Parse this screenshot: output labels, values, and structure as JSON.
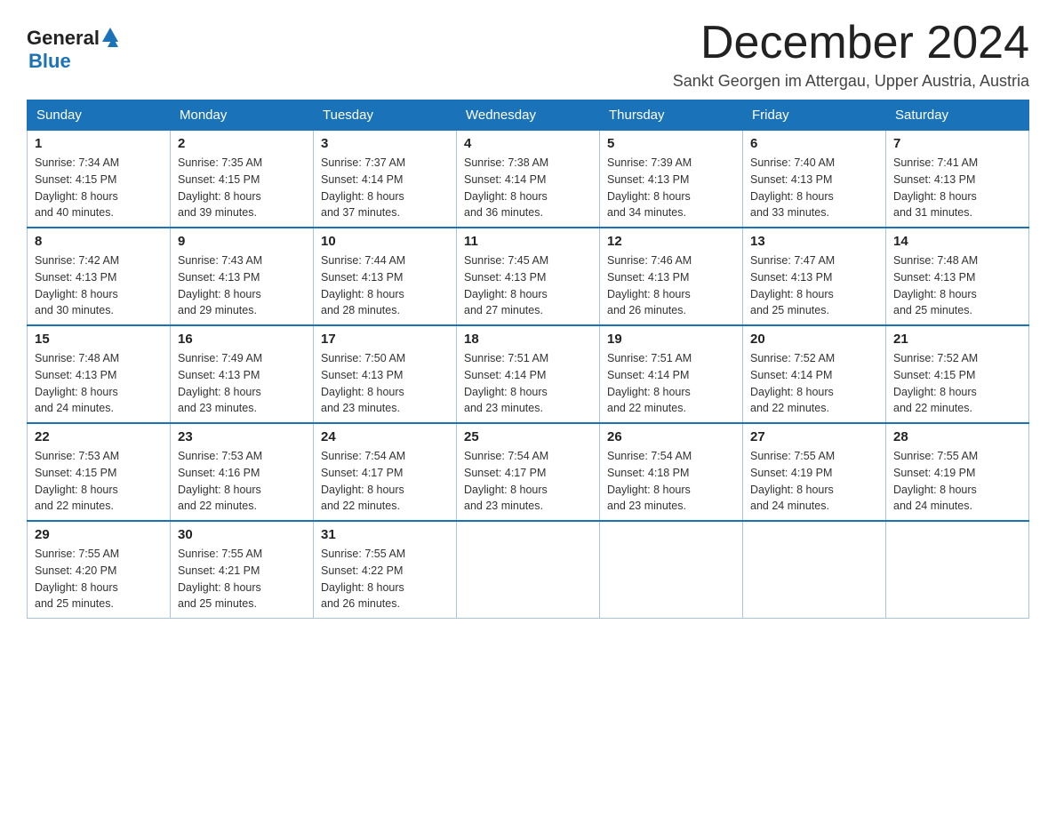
{
  "logo": {
    "general": "General",
    "blue": "Blue"
  },
  "title": "December 2024",
  "location": "Sankt Georgen im Attergau, Upper Austria, Austria",
  "days_header": [
    "Sunday",
    "Monday",
    "Tuesday",
    "Wednesday",
    "Thursday",
    "Friday",
    "Saturday"
  ],
  "weeks": [
    [
      {
        "day": "1",
        "sunrise": "7:34 AM",
        "sunset": "4:15 PM",
        "daylight": "8 hours and 40 minutes."
      },
      {
        "day": "2",
        "sunrise": "7:35 AM",
        "sunset": "4:15 PM",
        "daylight": "8 hours and 39 minutes."
      },
      {
        "day": "3",
        "sunrise": "7:37 AM",
        "sunset": "4:14 PM",
        "daylight": "8 hours and 37 minutes."
      },
      {
        "day": "4",
        "sunrise": "7:38 AM",
        "sunset": "4:14 PM",
        "daylight": "8 hours and 36 minutes."
      },
      {
        "day": "5",
        "sunrise": "7:39 AM",
        "sunset": "4:13 PM",
        "daylight": "8 hours and 34 minutes."
      },
      {
        "day": "6",
        "sunrise": "7:40 AM",
        "sunset": "4:13 PM",
        "daylight": "8 hours and 33 minutes."
      },
      {
        "day": "7",
        "sunrise": "7:41 AM",
        "sunset": "4:13 PM",
        "daylight": "8 hours and 31 minutes."
      }
    ],
    [
      {
        "day": "8",
        "sunrise": "7:42 AM",
        "sunset": "4:13 PM",
        "daylight": "8 hours and 30 minutes."
      },
      {
        "day": "9",
        "sunrise": "7:43 AM",
        "sunset": "4:13 PM",
        "daylight": "8 hours and 29 minutes."
      },
      {
        "day": "10",
        "sunrise": "7:44 AM",
        "sunset": "4:13 PM",
        "daylight": "8 hours and 28 minutes."
      },
      {
        "day": "11",
        "sunrise": "7:45 AM",
        "sunset": "4:13 PM",
        "daylight": "8 hours and 27 minutes."
      },
      {
        "day": "12",
        "sunrise": "7:46 AM",
        "sunset": "4:13 PM",
        "daylight": "8 hours and 26 minutes."
      },
      {
        "day": "13",
        "sunrise": "7:47 AM",
        "sunset": "4:13 PM",
        "daylight": "8 hours and 25 minutes."
      },
      {
        "day": "14",
        "sunrise": "7:48 AM",
        "sunset": "4:13 PM",
        "daylight": "8 hours and 25 minutes."
      }
    ],
    [
      {
        "day": "15",
        "sunrise": "7:48 AM",
        "sunset": "4:13 PM",
        "daylight": "8 hours and 24 minutes."
      },
      {
        "day": "16",
        "sunrise": "7:49 AM",
        "sunset": "4:13 PM",
        "daylight": "8 hours and 23 minutes."
      },
      {
        "day": "17",
        "sunrise": "7:50 AM",
        "sunset": "4:13 PM",
        "daylight": "8 hours and 23 minutes."
      },
      {
        "day": "18",
        "sunrise": "7:51 AM",
        "sunset": "4:14 PM",
        "daylight": "8 hours and 23 minutes."
      },
      {
        "day": "19",
        "sunrise": "7:51 AM",
        "sunset": "4:14 PM",
        "daylight": "8 hours and 22 minutes."
      },
      {
        "day": "20",
        "sunrise": "7:52 AM",
        "sunset": "4:14 PM",
        "daylight": "8 hours and 22 minutes."
      },
      {
        "day": "21",
        "sunrise": "7:52 AM",
        "sunset": "4:15 PM",
        "daylight": "8 hours and 22 minutes."
      }
    ],
    [
      {
        "day": "22",
        "sunrise": "7:53 AM",
        "sunset": "4:15 PM",
        "daylight": "8 hours and 22 minutes."
      },
      {
        "day": "23",
        "sunrise": "7:53 AM",
        "sunset": "4:16 PM",
        "daylight": "8 hours and 22 minutes."
      },
      {
        "day": "24",
        "sunrise": "7:54 AM",
        "sunset": "4:17 PM",
        "daylight": "8 hours and 22 minutes."
      },
      {
        "day": "25",
        "sunrise": "7:54 AM",
        "sunset": "4:17 PM",
        "daylight": "8 hours and 23 minutes."
      },
      {
        "day": "26",
        "sunrise": "7:54 AM",
        "sunset": "4:18 PM",
        "daylight": "8 hours and 23 minutes."
      },
      {
        "day": "27",
        "sunrise": "7:55 AM",
        "sunset": "4:19 PM",
        "daylight": "8 hours and 24 minutes."
      },
      {
        "day": "28",
        "sunrise": "7:55 AM",
        "sunset": "4:19 PM",
        "daylight": "8 hours and 24 minutes."
      }
    ],
    [
      {
        "day": "29",
        "sunrise": "7:55 AM",
        "sunset": "4:20 PM",
        "daylight": "8 hours and 25 minutes."
      },
      {
        "day": "30",
        "sunrise": "7:55 AM",
        "sunset": "4:21 PM",
        "daylight": "8 hours and 25 minutes."
      },
      {
        "day": "31",
        "sunrise": "7:55 AM",
        "sunset": "4:22 PM",
        "daylight": "8 hours and 26 minutes."
      },
      null,
      null,
      null,
      null
    ]
  ],
  "labels": {
    "sunrise": "Sunrise:",
    "sunset": "Sunset:",
    "daylight": "Daylight:"
  }
}
